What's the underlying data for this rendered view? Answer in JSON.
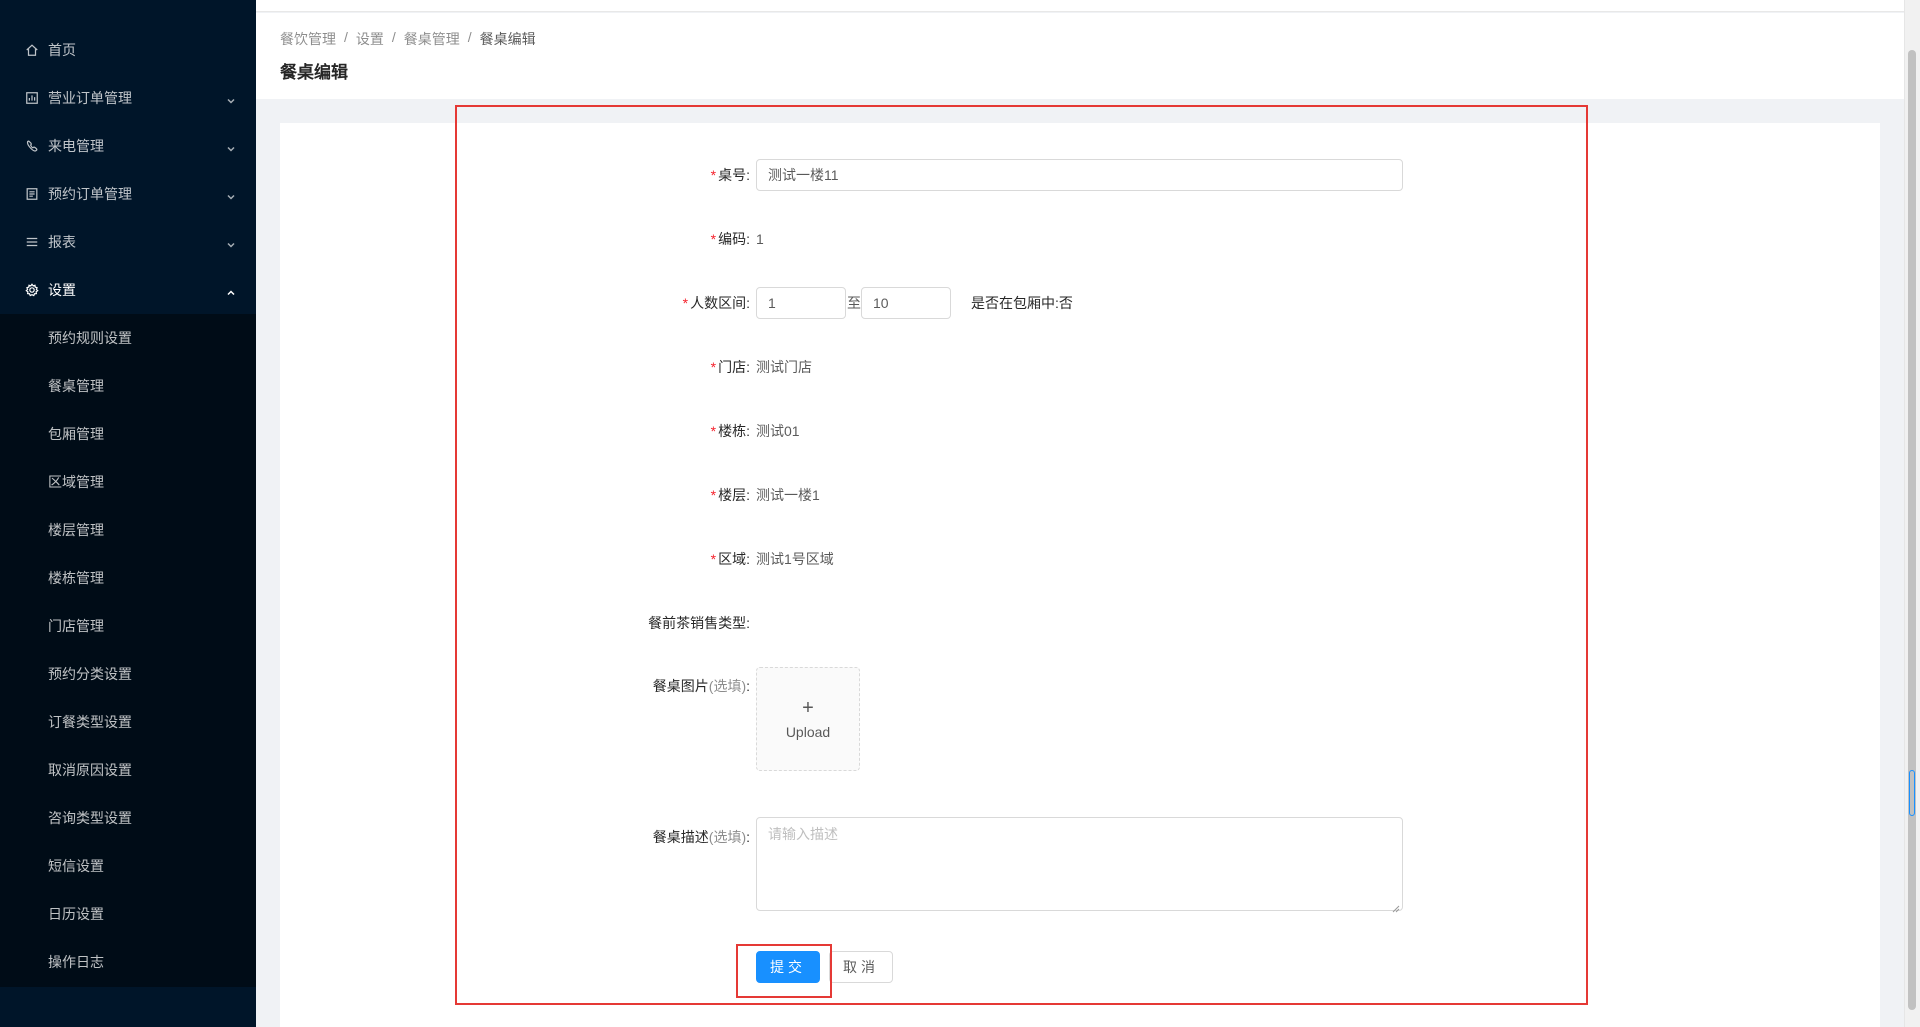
{
  "sidebar": {
    "items": [
      {
        "label": "首页",
        "icon": "home-icon"
      },
      {
        "label": "营业订单管理",
        "icon": "chart-icon"
      },
      {
        "label": "来电管理",
        "icon": "phone-icon"
      },
      {
        "label": "预约订单管理",
        "icon": "list-icon"
      },
      {
        "label": "报表",
        "icon": "menu-icon"
      },
      {
        "label": "设置",
        "icon": "gear-icon"
      }
    ],
    "sub_items": [
      "预约规则设置",
      "餐桌管理",
      "包厢管理",
      "区域管理",
      "楼层管理",
      "楼栋管理",
      "门店管理",
      "预约分类设置",
      "订餐类型设置",
      "取消原因设置",
      "咨询类型设置",
      "短信设置",
      "日历设置",
      "操作日志"
    ]
  },
  "breadcrumb": [
    "餐饮管理",
    "设置",
    "餐桌管理",
    "餐桌编辑"
  ],
  "breadcrumb_sep": "/",
  "page_title": "餐桌编辑",
  "form": {
    "table_no": {
      "label": "桌号:",
      "value": "测试一楼11"
    },
    "code": {
      "label": "编码:",
      "value": "1"
    },
    "people": {
      "label": "人数区间:",
      "min": "1",
      "to": "至",
      "max": "10",
      "private_room": "是否在包厢中:否"
    },
    "store": {
      "label": "门店:",
      "value": "测试门店"
    },
    "building": {
      "label": "楼栋:",
      "value": "测试01"
    },
    "floor": {
      "label": "楼层:",
      "value": "测试一楼1"
    },
    "area": {
      "label": "区域:",
      "value": "测试1号区域"
    },
    "tea_type": {
      "label": "餐前茶销售类型:"
    },
    "image": {
      "label": "餐桌图片",
      "optional": "(选填)",
      "colon": ":",
      "upload_plus": "+",
      "upload_text": "Upload"
    },
    "desc": {
      "label": "餐桌描述",
      "optional": "(选填)",
      "colon": ":",
      "placeholder": "请输入描述"
    },
    "required_mark": "*"
  },
  "buttons": {
    "submit": "提交",
    "cancel": "取消"
  },
  "colors": {
    "sidebar_bg": "#001529",
    "primary": "#1890ff",
    "annotation": "#e53935"
  }
}
